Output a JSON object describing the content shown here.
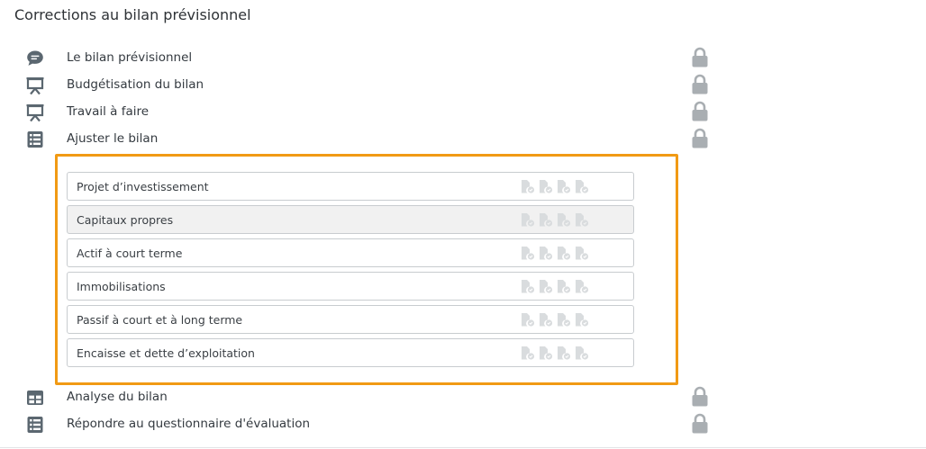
{
  "page_title": "Corrections au bilan prévisionnel",
  "colors": {
    "accent_frame": "#f19a14",
    "icon": "#5b6770",
    "lock": "#a9aeb2",
    "doc_icon": "#d9dcde"
  },
  "steps": [
    {
      "label": "Le bilan prévisionnel",
      "icon": "chat-bubble-icon",
      "locked": true
    },
    {
      "label": "Budgétisation du bilan",
      "icon": "presentation-board-icon",
      "locked": true
    },
    {
      "label": "Travail à faire",
      "icon": "presentation-board-icon",
      "locked": true
    },
    {
      "label": "Ajuster le bilan",
      "icon": "list-icon",
      "locked": true
    },
    {
      "label": "Analyse du bilan",
      "icon": "table-icon",
      "locked": true
    },
    {
      "label": "Répondre au questionnaire d'évaluation",
      "icon": "list-icon",
      "locked": true
    }
  ],
  "subitems": [
    {
      "label": "Projet d’investissement",
      "selected": false
    },
    {
      "label": "Capitaux propres",
      "selected": true
    },
    {
      "label": "Actif à court terme",
      "selected": false
    },
    {
      "label": "Immobilisations",
      "selected": false
    },
    {
      "label": "Passif à court et à long terme",
      "selected": false
    },
    {
      "label": "Encaisse et dette d’exploitation",
      "selected": false
    }
  ]
}
